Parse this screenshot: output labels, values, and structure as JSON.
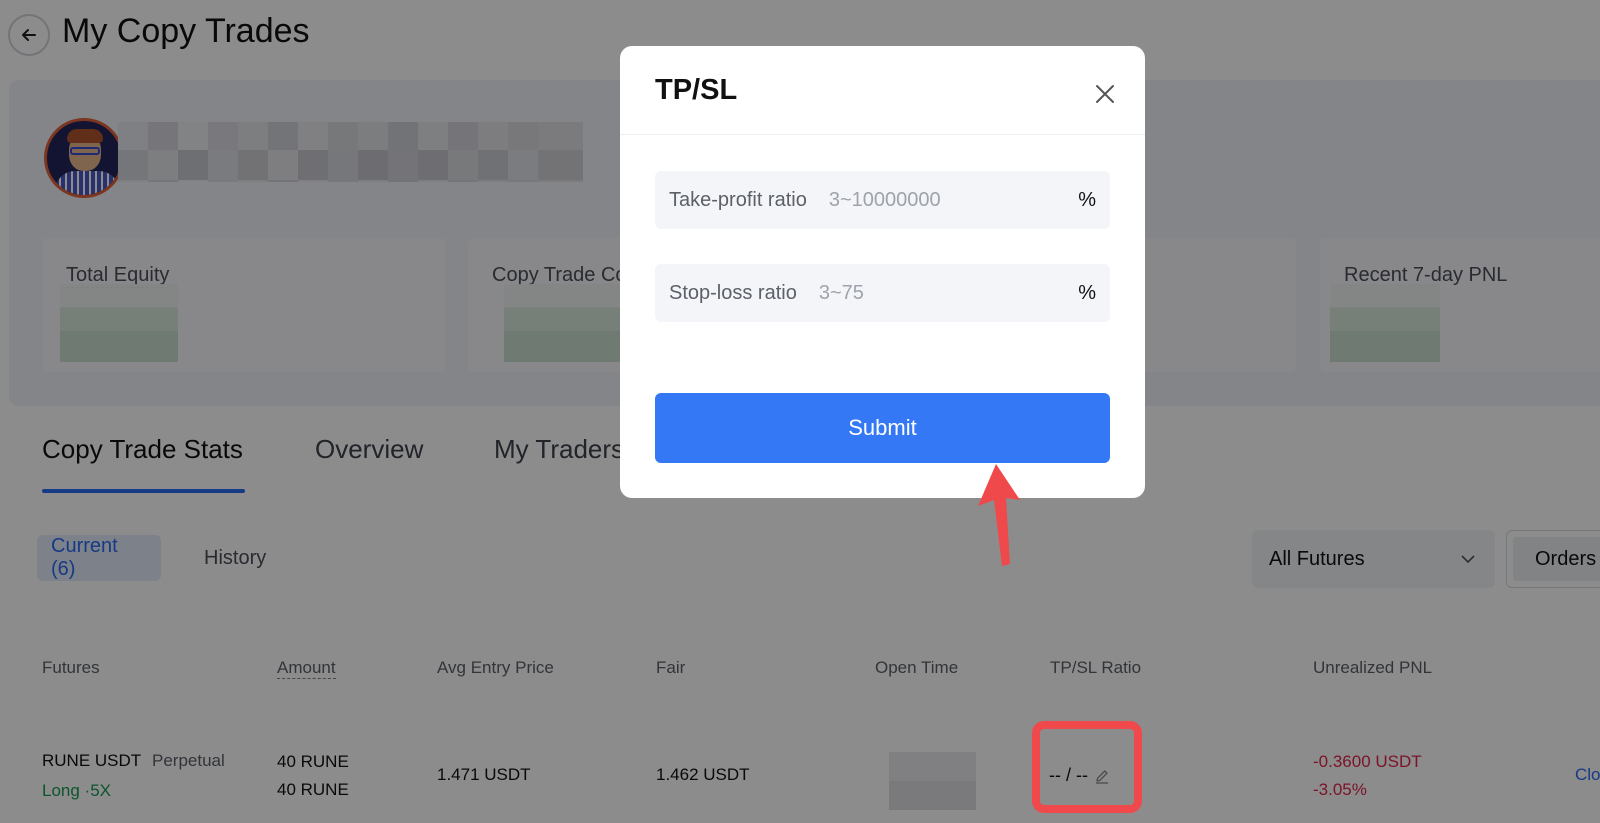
{
  "header": {
    "title": "My Copy Trades"
  },
  "stats": [
    {
      "label": "Total Equity"
    },
    {
      "label": "Copy Trade Co"
    },
    {
      "label": "Recent 7-day PNL"
    }
  ],
  "tabs": [
    {
      "label": "Copy Trade Stats"
    },
    {
      "label": "Overview"
    },
    {
      "label": "My Traders"
    }
  ],
  "filters": {
    "current": "Current (6)",
    "history": "History",
    "futures_select": "All Futures",
    "orders": "Orders"
  },
  "table": {
    "columns": [
      "Futures",
      "Amount",
      "Avg Entry Price",
      "Fair",
      "Open Time",
      "TP/SL Ratio",
      "Unrealized PNL"
    ],
    "row": {
      "pair": "RUNE USDT",
      "contract": "Perpetual",
      "side": "Long ·5X",
      "amount1": "40 RUNE",
      "amount2": "40 RUNE",
      "avg_entry": "1.471 USDT",
      "fair": "1.462 USDT",
      "tpsl": "-- / --",
      "pnl": "-0.3600 USDT",
      "pnl_pct": "-3.05%",
      "action": "Clo"
    }
  },
  "modal": {
    "title": "TP/SL",
    "take_profit": {
      "label": "Take-profit ratio",
      "placeholder": "3~10000000",
      "unit": "%"
    },
    "stop_loss": {
      "label": "Stop-loss ratio",
      "placeholder": "3~75",
      "unit": "%"
    },
    "submit": "Submit"
  },
  "colors": {
    "accent": "#3478f6",
    "highlight": "#f0494b",
    "profit": "#1a9a52",
    "loss": "#e0264b"
  }
}
